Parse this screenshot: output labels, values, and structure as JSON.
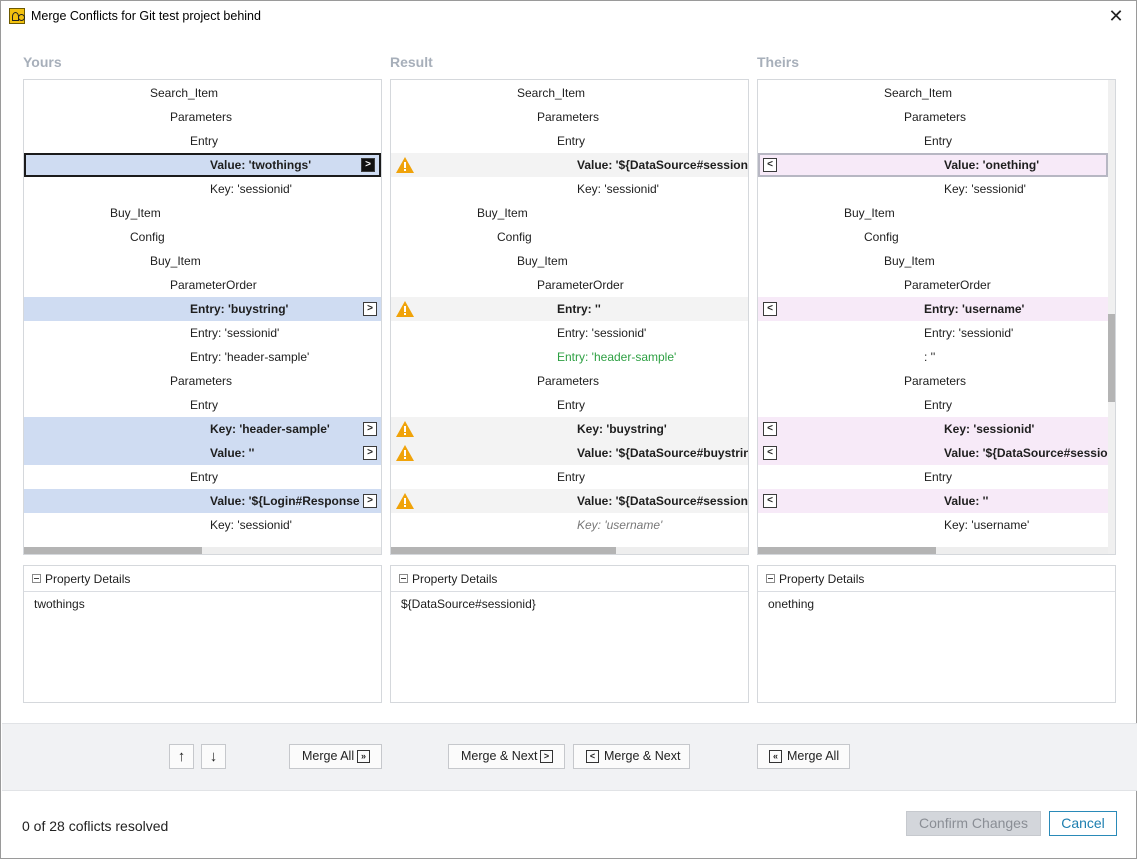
{
  "window": {
    "title": "Merge Conflicts for Git test project behind"
  },
  "columns": {
    "yours": "Yours",
    "result": "Result",
    "theirs": "Theirs"
  },
  "yours_rows": [
    "Search_Item",
    "Parameters",
    "Entry",
    "Value: 'twothings'",
    "Key: 'sessionid'",
    "Buy_Item",
    "Config",
    "Buy_Item",
    "ParameterOrder",
    "Entry: 'buystring'",
    "Entry: 'sessionid'",
    "Entry: 'header-sample'",
    "Parameters",
    "Entry",
    "Key: 'header-sample'",
    "Value: ''",
    "Entry",
    "Value: '${Login#Response#",
    "Key: 'sessionid'"
  ],
  "result_rows": [
    "Search_Item",
    "Parameters",
    "Entry",
    "Value: '${DataSource#sessionid",
    "Key: 'sessionid'",
    "Buy_Item",
    "Config",
    "Buy_Item",
    "ParameterOrder",
    "Entry: ''",
    "Entry: 'sessionid'",
    "Entry: 'header-sample'",
    "Parameters",
    "Entry",
    "Key: 'buystring'",
    "Value: '${DataSource#buystring",
    "Entry",
    "Value: '${DataSource#sessionid",
    "Key: 'username'"
  ],
  "theirs_rows": [
    "Search_Item",
    "Parameters",
    "Entry",
    "Value: 'onething'",
    "Key: 'sessionid'",
    "Buy_Item",
    "Config",
    "Buy_Item",
    "ParameterOrder",
    "Entry: 'username'",
    "Entry: 'sessionid'",
    ": ''",
    "Parameters",
    "Entry",
    "Key: 'sessionid'",
    "Value: '${DataSource#session",
    "Entry",
    "Value: ''",
    "Key: 'username'"
  ],
  "details": {
    "header": "Property Details",
    "yours_value": "twothings",
    "result_value": "${DataSource#sessionid}",
    "theirs_value": "onething"
  },
  "icons": {
    "up": "arrow-up-icon",
    "down": "arrow-down-icon",
    "warning": "warning-icon",
    "take_right": "chevron-right-icon",
    "take_left": "chevron-left-icon",
    "right_double": "double-chevron-right-icon",
    "left_double": "double-chevron-left-icon",
    "glyph_up": "↑",
    "glyph_down": "↓",
    "glyph_right": ">",
    "glyph_left": "<",
    "glyph_right_double": "»",
    "glyph_left_double": "«",
    "glyph_close": "✕"
  },
  "buttons": {
    "merge_all_yours": "Merge All",
    "merge_next_yours": "Merge & Next",
    "merge_next_theirs": "Merge & Next",
    "merge_all_theirs": "Merge All",
    "confirm": "Confirm Changes",
    "cancel": "Cancel"
  },
  "status": "0 of 28 coflicts resolved",
  "colors": {
    "yours_conflict": "#cfdcf2",
    "result_conflict": "#f3f3f3",
    "theirs_conflict": "#f7eaf8",
    "warning": "#f0a30a",
    "added_text": "#2ea043",
    "cancel_accent": "#1e7fb0"
  }
}
